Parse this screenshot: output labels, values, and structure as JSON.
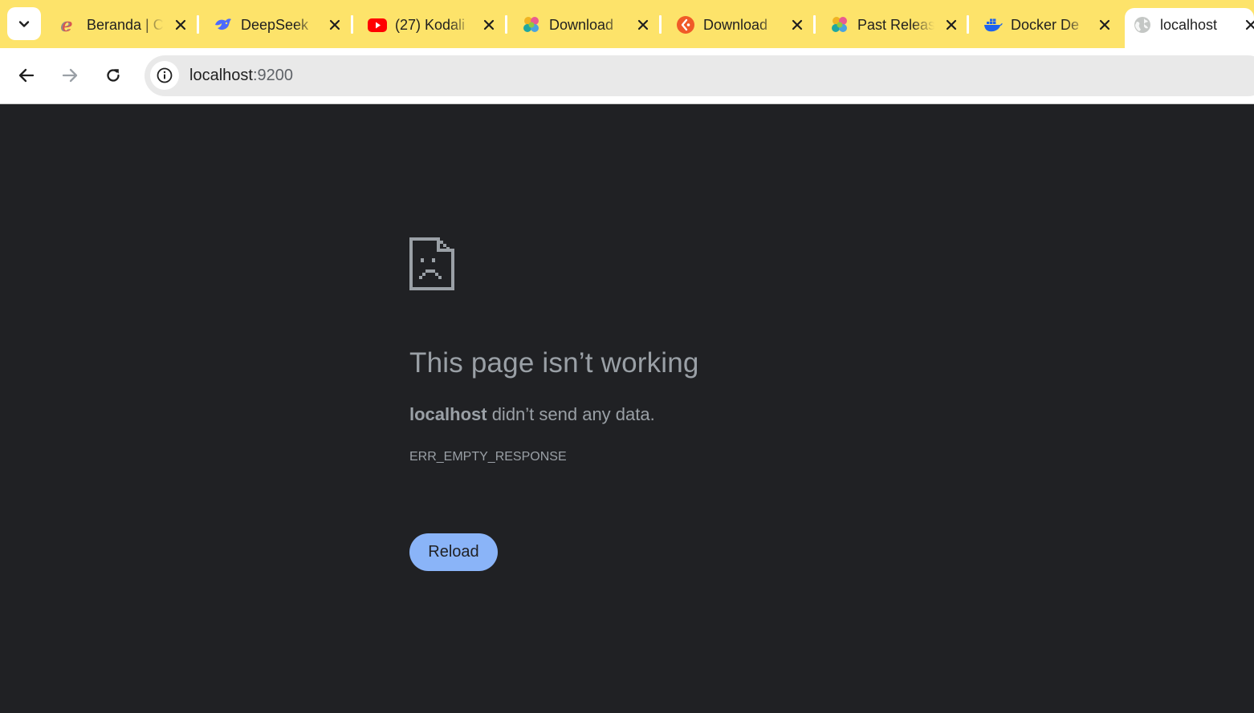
{
  "browser": {
    "tabs": [
      {
        "title": "Beranda | C",
        "favicon": "edge-e-icon",
        "active": false
      },
      {
        "title": "DeepSeek",
        "favicon": "deepseek-whale-icon",
        "active": false
      },
      {
        "title": "(27) Kodali",
        "favicon": "youtube-icon",
        "active": false
      },
      {
        "title": "Download",
        "favicon": "elastic-icon",
        "active": false
      },
      {
        "title": "Download",
        "favicon": "orange-circle-icon",
        "active": false
      },
      {
        "title": "Past Releas",
        "favicon": "elastic-icon",
        "active": false
      },
      {
        "title": "Docker De",
        "favicon": "docker-whale-icon",
        "active": false
      },
      {
        "title": "localhost",
        "favicon": "globe-icon",
        "active": true
      }
    ],
    "tab_close_glyph": "✕",
    "omnibox": {
      "host": "localhost",
      "port": ":9200"
    },
    "colors": {
      "tabstrip": "#fde36a",
      "toolbar": "#ffffff",
      "page_background": "#202124",
      "button_accent": "#8ab4f8"
    }
  },
  "error_page": {
    "icon": "sad-page-icon",
    "heading": "This page isn’t working",
    "host": "localhost",
    "message_rest": " didn’t send any data.",
    "error_code": "ERR_EMPTY_RESPONSE",
    "reload_label": "Reload"
  }
}
